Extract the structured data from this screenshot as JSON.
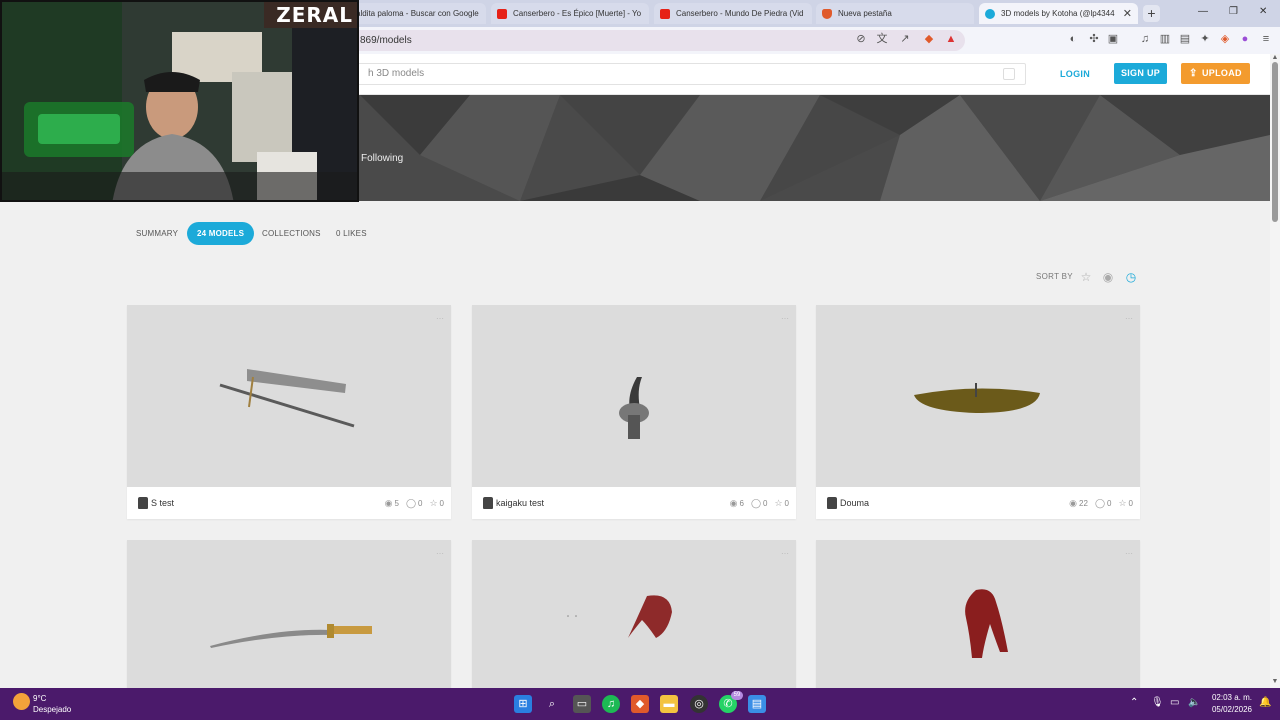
{
  "browser": {
    "tabs": [
      {
        "title": "aldita paloma - Buscar con Google",
        "icon": "google-icon"
      },
      {
        "title": "Canserbero - Es Épico [Muerte] - Yo",
        "icon": "youtube-icon"
      },
      {
        "title": "Canserbero - Mundo De Piedra (Vid",
        "icon": "youtube-icon"
      },
      {
        "title": "Nueva pestaña",
        "icon": "brave-icon"
      },
      {
        "title": "3D models by Kotoha (@lp4344",
        "icon": "sketchfab-icon",
        "active": true
      }
    ],
    "url": "869/models"
  },
  "webcam": {
    "logo": "ZERAL"
  },
  "header": {
    "search_placeholder": "h 3D models",
    "login": "LOGIN",
    "signup": "SIGN UP",
    "upload": "UPLOAD"
  },
  "banner": {
    "following": "Following"
  },
  "profile_tabs": [
    {
      "label": "SUMMARY"
    },
    {
      "label": "24 MODELS",
      "active": true
    },
    {
      "label": "COLLECTIONS"
    },
    {
      "label": "0 LIKES"
    }
  ],
  "sort": {
    "label": "SORT BY"
  },
  "models": [
    {
      "title": "S test",
      "views": "5",
      "comments": "0",
      "likes": "0"
    },
    {
      "title": "kaigaku test",
      "views": "6",
      "comments": "0",
      "likes": "0"
    },
    {
      "title": "Douma",
      "views": "22",
      "comments": "0",
      "likes": "0"
    },
    {
      "title": "",
      "views": "",
      "comments": "",
      "likes": ""
    },
    {
      "title": "",
      "views": "",
      "comments": "",
      "likes": ""
    },
    {
      "title": "",
      "views": "",
      "comments": "",
      "likes": ""
    }
  ],
  "taskbar": {
    "temperature": "9°C",
    "weather": "Despejado",
    "time": "02:03 a. m.",
    "date": "05/02/2026",
    "whatsapp_badge": "59"
  },
  "colors": {
    "accent": "#1caad9",
    "upload": "#f39b2e",
    "taskbar": "#4b1a6b"
  }
}
